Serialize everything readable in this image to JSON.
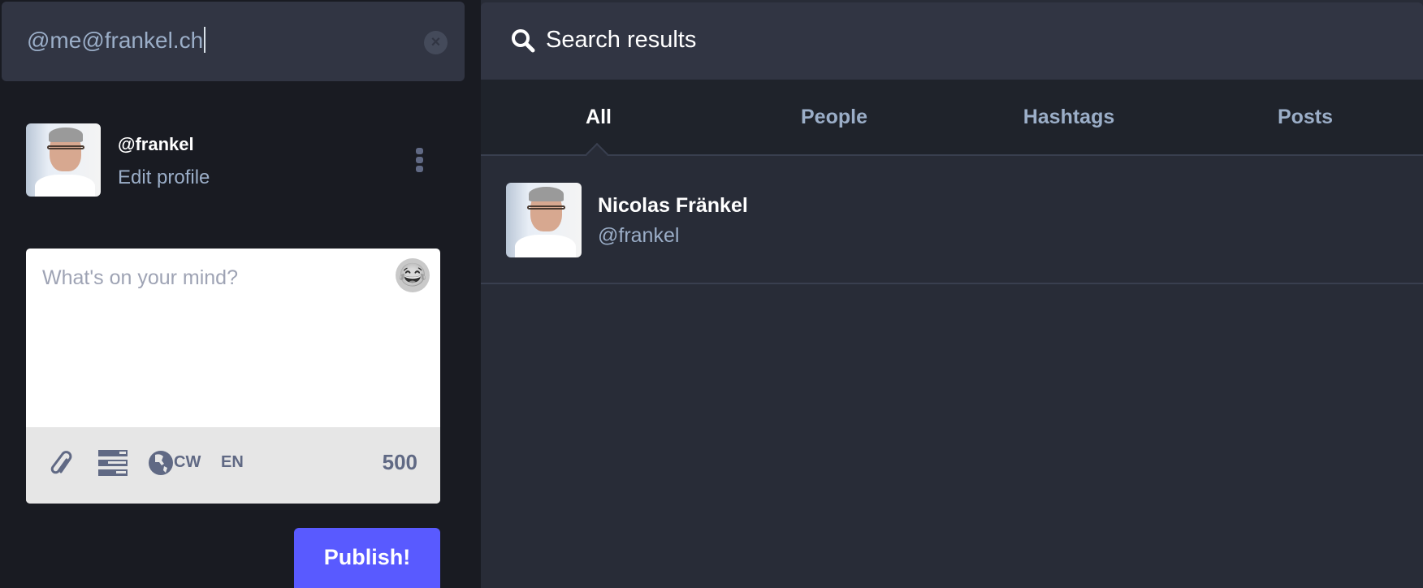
{
  "search": {
    "value": "@me@frankel.ch",
    "clear_icon": "close-circle-icon"
  },
  "profile": {
    "handle": "@frankel",
    "edit_label": "Edit profile",
    "menu_icon": "kebab-menu-icon"
  },
  "composer": {
    "placeholder": "What's on your mind?",
    "emoji_icon": "laughing-emoji-icon",
    "tools": {
      "attach_icon": "paperclip-icon",
      "poll_icon": "poll-icon",
      "visibility_icon": "globe-icon",
      "cw_label": "CW",
      "language_label": "EN"
    },
    "char_count": "500",
    "publish_label": "Publish!"
  },
  "results": {
    "header_title": "Search results",
    "tabs": [
      {
        "label": "All",
        "active": true
      },
      {
        "label": "People"
      },
      {
        "label": "Hashtags"
      },
      {
        "label": "Posts"
      }
    ],
    "accounts": [
      {
        "display_name": "Nicolas Fränkel",
        "handle": "@frankel"
      }
    ]
  },
  "colors": {
    "accent": "#595aff",
    "secondary_text": "#9baec8",
    "background": "#191b22",
    "panel": "#282c37"
  }
}
